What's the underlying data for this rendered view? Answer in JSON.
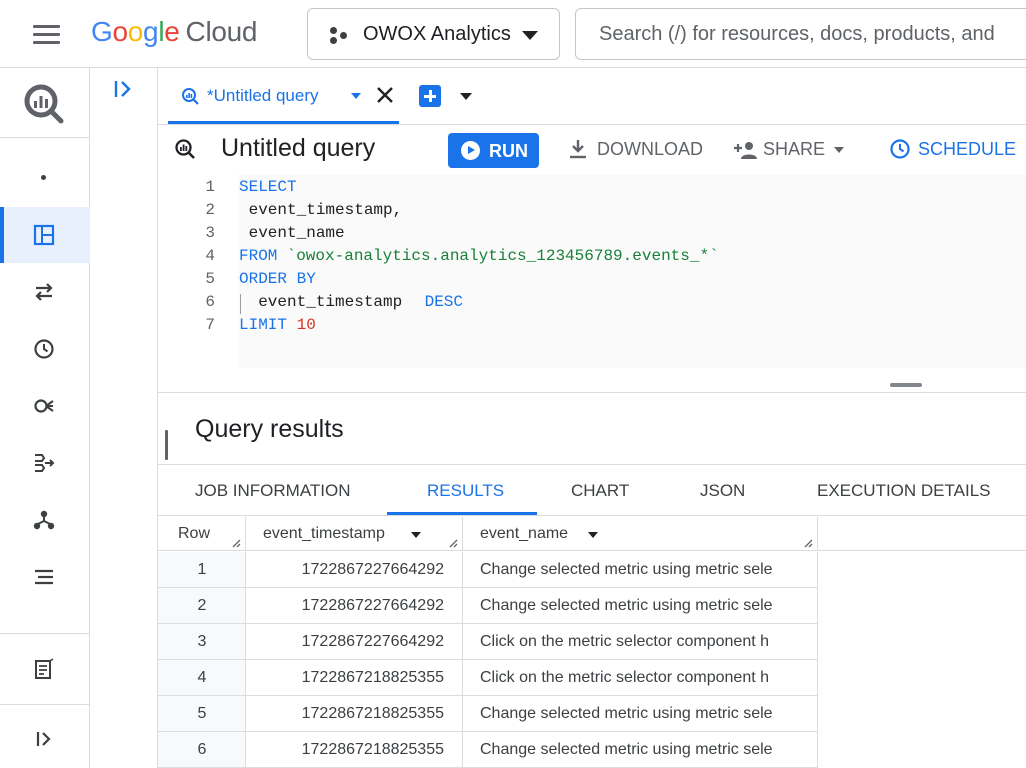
{
  "topbar": {
    "logo": {
      "google_letters": [
        "G",
        "o",
        "o",
        "g",
        "l",
        "e"
      ],
      "cloud": "Cloud"
    },
    "project_name": "OWOX Analytics",
    "search_placeholder": "Search (/) for resources, docs, products, and"
  },
  "query_tab": {
    "label": "*Untitled query"
  },
  "toolbar": {
    "title": "Untitled query",
    "run": "RUN",
    "download": "DOWNLOAD",
    "share": "SHARE",
    "schedule": "SCHEDULE"
  },
  "editor": {
    "lines": [
      {
        "n": "1",
        "t1": "SELECT"
      },
      {
        "n": "2",
        "t1": " event_timestamp,"
      },
      {
        "n": "3",
        "t1": " event_name"
      },
      {
        "n": "4",
        "t1": "FROM",
        "t2": " `owox-analytics.analytics_123456789.events_*`"
      },
      {
        "n": "5",
        "t1": "ORDER BY"
      },
      {
        "n": "6",
        "t1": "  event_timestamp",
        "t2": " DESC"
      },
      {
        "n": "7",
        "t1": "LIMIT",
        "t2": " 10"
      }
    ]
  },
  "results": {
    "title": "Query results",
    "tabs": [
      "JOB INFORMATION",
      "RESULTS",
      "CHART",
      "JSON",
      "EXECUTION DETAILS"
    ],
    "active_tab": "RESULTS",
    "columns": [
      "Row",
      "event_timestamp",
      "event_name"
    ],
    "rows": [
      {
        "row": "1",
        "event_timestamp": "1722867227664292",
        "event_name": "Change selected metric using metric sele"
      },
      {
        "row": "2",
        "event_timestamp": "1722867227664292",
        "event_name": "Change selected metric using metric sele"
      },
      {
        "row": "3",
        "event_timestamp": "1722867227664292",
        "event_name": "Click on the metric selector component h"
      },
      {
        "row": "4",
        "event_timestamp": "1722867218825355",
        "event_name": "Click on the metric selector component h"
      },
      {
        "row": "5",
        "event_timestamp": "1722867218825355",
        "event_name": "Change selected metric using metric sele"
      },
      {
        "row": "6",
        "event_timestamp": "1722867218825355",
        "event_name": "Change selected metric using metric sele"
      }
    ]
  },
  "left_rail": {
    "icons": [
      "bigquery-logo-icon",
      "dot-icon",
      "studio-icon",
      "transfers-icon",
      "scheduled-queries-icon",
      "analytics-hub-icon",
      "dataform-icon",
      "pipelines-icon",
      "settings-list-icon",
      "release-notes-icon",
      "expand-icon"
    ],
    "active": "studio-icon"
  },
  "colors": {
    "accent": "#1a73e8",
    "string": "#188038",
    "number": "#d93025",
    "divider": "#dadce0"
  }
}
